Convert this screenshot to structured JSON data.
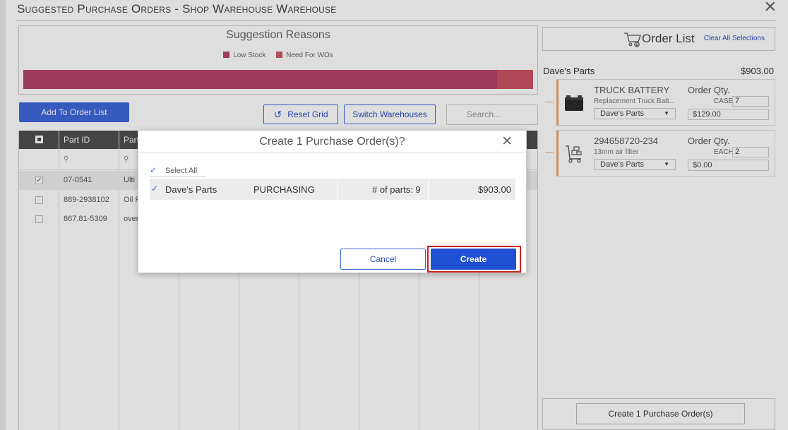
{
  "window": {
    "title": "Suggested Purchase Orders - Shop Warehouse Warehouse",
    "close_icon": "close-icon"
  },
  "chart_data": {
    "type": "bar",
    "title": "Suggestion Reasons",
    "orientation": "horizontal-stacked",
    "series": [
      {
        "name": "Low Stock",
        "value": 93,
        "color": "#b5446b"
      },
      {
        "name": "Need For WOs",
        "value": 7,
        "color": "#cc5566"
      }
    ],
    "legend_position": "top-center"
  },
  "toolbar": {
    "add_to_order_list": "Add To Order List",
    "reset_grid": "Reset Grid",
    "reset_icon": "refresh-icon",
    "switch_warehouses": "Switch Warehouses",
    "search_placeholder": "Search..."
  },
  "grid": {
    "columns": [
      "Part ID",
      "Part"
    ],
    "rows": [
      {
        "part_id": "07-0541",
        "part": "Ulti",
        "checked": true
      },
      {
        "part_id": "889-2938102",
        "part": "Oil F",
        "checked": false
      },
      {
        "part_id": "867.81-5309",
        "part": "over",
        "checked": false
      }
    ]
  },
  "order_list": {
    "title": "Order List",
    "clear_label": "Clear All Selections",
    "vendor": {
      "name": "Dave's Parts",
      "total": "$903.00"
    },
    "items": [
      {
        "name": "TRUCK BATTERY",
        "description": "Replacement Truck Batt...",
        "vendor": "Dave's Parts",
        "qty_label": "Order Qty.",
        "unit": "CASE",
        "qty": "7",
        "price": "$129.00",
        "thumb_icon": "battery-icon"
      },
      {
        "name": "294658720-234",
        "description": "13mm air filter",
        "vendor": "Dave's Parts",
        "qty_label": "Order Qty.",
        "unit": "EACH",
        "qty": "2",
        "price": "$0.00",
        "thumb_icon": "hand-truck-icon"
      }
    ],
    "footer_button": "Create 1 Purchase Order(s)"
  },
  "modal": {
    "title": "Create 1 Purchase Order(s)?",
    "select_all": "Select All",
    "rows": [
      {
        "vendor": "Dave's Parts",
        "department": "PURCHASING",
        "parts": "# of parts: 9",
        "amount": "$903.00"
      }
    ],
    "cancel": "Cancel",
    "create": "Create",
    "highlight_color": "#cc1f1f"
  }
}
